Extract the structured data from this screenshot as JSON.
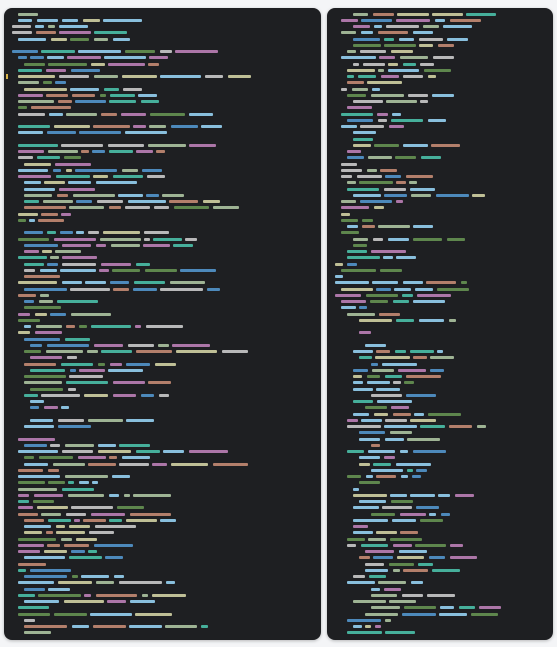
{
  "theme": {
    "editor_background": "#1e1f22",
    "page_background": "#f4f5f7",
    "syntax_colors": {
      "keyword": "#c586c0",
      "variable": "#9cdcfe",
      "string": "#ce9178",
      "function": "#dcdcaa",
      "tag": "#569cd6",
      "attribute": "#9cdcfe",
      "comment": "#6a9955",
      "punctuation": "#d4d4d4",
      "type": "#4ec9b0",
      "number": "#b5cea8"
    }
  },
  "panes": [
    {
      "name": "left-code-pane",
      "language": "javascript",
      "visible_text": []
    },
    {
      "name": "right-code-pane",
      "language": "html",
      "visible_text": []
    }
  ]
}
